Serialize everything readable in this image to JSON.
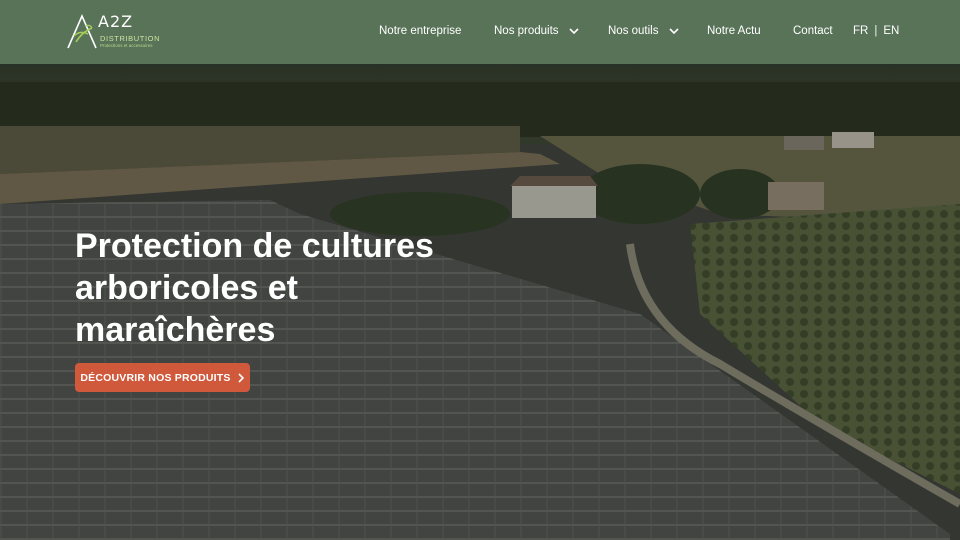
{
  "brand": {
    "name": "A2Z",
    "subtitle": "DISTRIBUTION",
    "tagline": "Protections et accessoires",
    "colors": {
      "header": "#597359",
      "cta": "#d0583b",
      "logo_green": "#a8cc5a"
    }
  },
  "nav": {
    "items": [
      {
        "label": "Notre entreprise",
        "has_dropdown": false
      },
      {
        "label": "Nos produits",
        "has_dropdown": true
      },
      {
        "label": "Nos outils",
        "has_dropdown": true
      },
      {
        "label": "Notre Actu",
        "has_dropdown": false
      },
      {
        "label": "Contact",
        "has_dropdown": false
      }
    ],
    "lang": {
      "fr": "FR",
      "sep": "|",
      "en": "EN"
    }
  },
  "hero": {
    "title": "Protection de cultures arboricoles et maraîchères",
    "cta_label": "DÉCOUVRIR NOS PRODUITS",
    "cta_icon": "chevron-right-icon"
  }
}
